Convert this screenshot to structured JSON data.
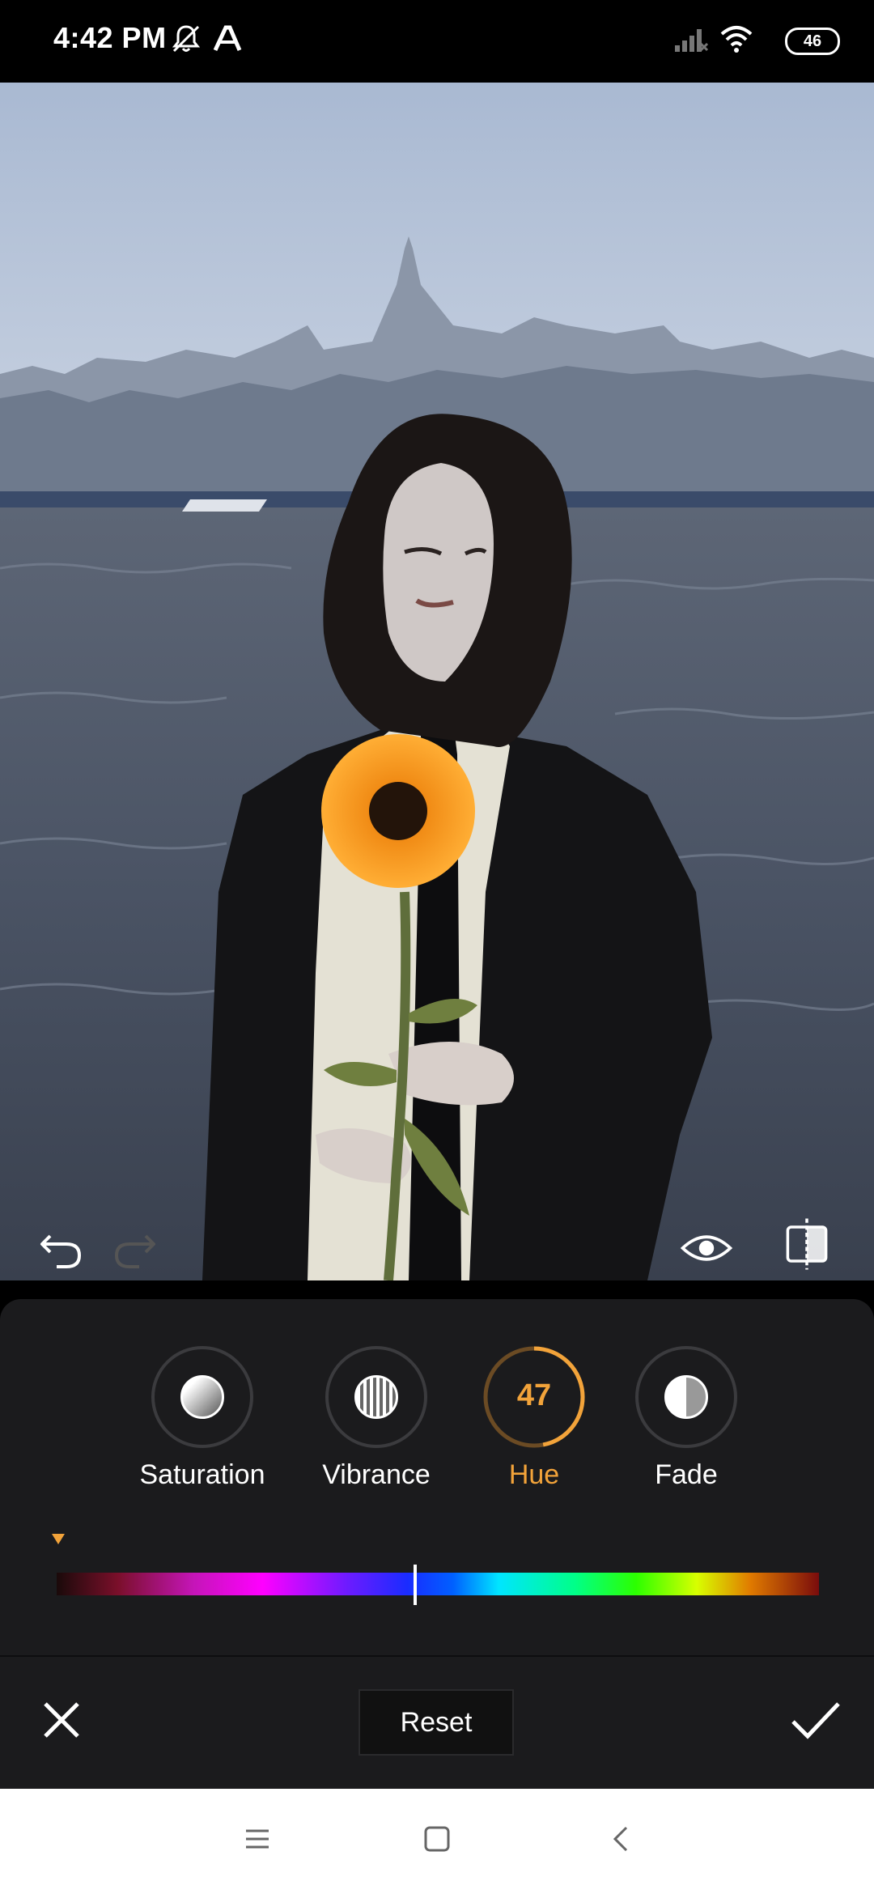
{
  "status_bar": {
    "time": "4:42 PM",
    "battery": "46",
    "icons": [
      "mute-icon",
      "a-icon",
      "signal-icon",
      "wifi-icon",
      "battery-icon"
    ]
  },
  "editor": {
    "toolbar_icons": [
      "undo-icon",
      "redo-icon",
      "eye-icon",
      "compare-icon"
    ]
  },
  "adjust_tools": [
    {
      "label": "Saturation",
      "icon": "saturation-icon"
    },
    {
      "label": "Vibrance",
      "icon": "vibrance-icon"
    },
    {
      "label": "Hue",
      "value": "47",
      "active": true
    },
    {
      "label": "Fade",
      "icon": "fade-icon"
    }
  ],
  "hue_slider": {
    "level": 0.47,
    "accent": "#f2a33a"
  },
  "actions": {
    "cancel_icon": "close-icon",
    "reset_label": "Reset",
    "confirm_icon": "check-icon"
  },
  "nav_bar": {
    "icons": [
      "menu-icon",
      "home-icon",
      "back-icon"
    ]
  }
}
